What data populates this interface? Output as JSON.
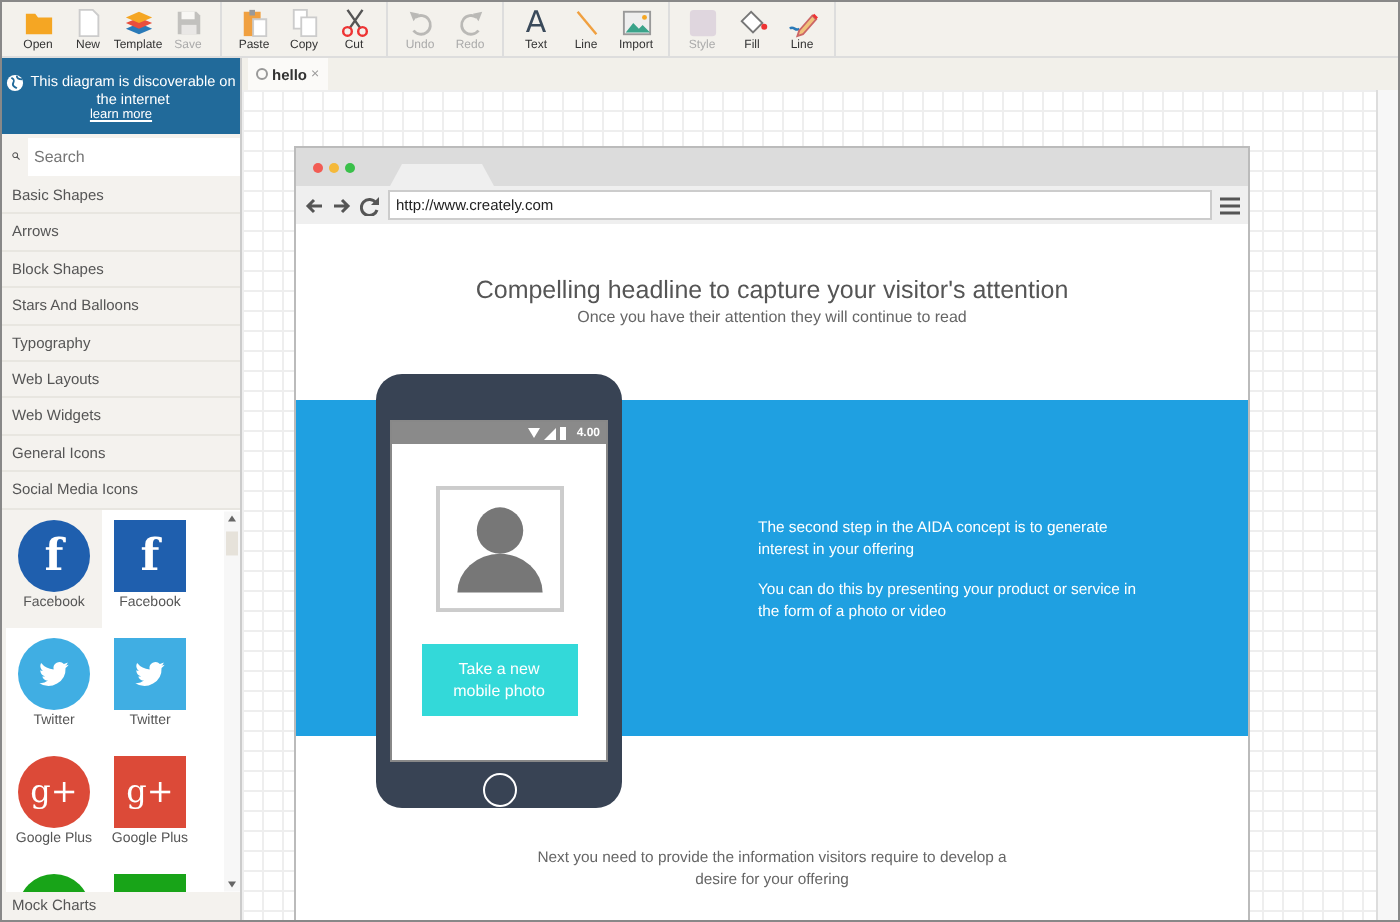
{
  "toolbar": {
    "groups": [
      {
        "items": [
          {
            "label": "Open",
            "kind": "folder",
            "disabled": false
          },
          {
            "label": "New",
            "kind": "page",
            "disabled": false
          },
          {
            "label": "Template",
            "kind": "layers",
            "disabled": false
          },
          {
            "label": "Save",
            "kind": "disk",
            "disabled": true
          }
        ]
      },
      {
        "items": [
          {
            "label": "Paste",
            "kind": "clipboard",
            "disabled": false
          },
          {
            "label": "Copy",
            "kind": "copy",
            "disabled": false
          },
          {
            "label": "Cut",
            "kind": "scissors",
            "disabled": false
          }
        ]
      },
      {
        "items": [
          {
            "label": "Undo",
            "kind": "undo",
            "disabled": true
          },
          {
            "label": "Redo",
            "kind": "redo",
            "disabled": true
          }
        ]
      },
      {
        "items": [
          {
            "label": "Text",
            "kind": "glyph",
            "glyph": "A",
            "disabled": false
          },
          {
            "label": "Line",
            "kind": "line",
            "disabled": false
          },
          {
            "label": "Import",
            "kind": "image",
            "disabled": false
          }
        ]
      },
      {
        "items": [
          {
            "label": "Style",
            "kind": "swatch",
            "disabled": true
          },
          {
            "label": "Fill",
            "kind": "bucket",
            "disabled": false
          },
          {
            "label": "Line",
            "kind": "pen",
            "disabled": false
          }
        ]
      }
    ]
  },
  "sidebar": {
    "banner": {
      "text": "This diagram is discoverable on the internet",
      "link": "learn more"
    },
    "search": {
      "placeholder": "Search"
    },
    "categories": [
      "Basic Shapes",
      "Arrows",
      "Block Shapes",
      "Stars And Balloons",
      "Typography",
      "Web Layouts",
      "Web Widgets",
      "General Icons",
      "Social Media Icons"
    ],
    "shapes": [
      {
        "label": "Facebook",
        "kind": "round",
        "glyph": "f",
        "color": "#1f5fae",
        "selected": true
      },
      {
        "label": "Facebook",
        "kind": "square",
        "glyph": "f",
        "color": "#1f5fae",
        "selected": false
      },
      {
        "label": "Twitter",
        "kind": "round-bird",
        "color": "#40aee3",
        "selected": false
      },
      {
        "label": "Twitter",
        "kind": "square-bird",
        "color": "#40aee3",
        "selected": false
      },
      {
        "label": "Google Plus",
        "kind": "round",
        "glyph": "g+",
        "color": "#dc4a38",
        "selected": false
      },
      {
        "label": "Google Plus",
        "kind": "square",
        "glyph": "g+",
        "color": "#dc4a38",
        "selected": false
      },
      {
        "kind": "round",
        "color": "#18a418",
        "selected": false
      },
      {
        "kind": "square",
        "color": "#18a418",
        "selected": false
      }
    ],
    "footer": "Mock Charts"
  },
  "tabs": [
    {
      "label": "hello",
      "close": "×",
      "selected": true
    }
  ],
  "mockup": {
    "url": "http://www.creately.com",
    "headline": "Compelling headline to capture your visitor's attention",
    "subheadline": "Once you have their attention they will continue to read",
    "phone": {
      "time": "4.00",
      "button": "Take a new mobile photo"
    },
    "band_paragraphs": [
      "The second step in the AIDA concept is to generate interest in your offering",
      "You can do this by presenting your product or service in the form of a photo or video"
    ],
    "bottom_text": "Next you need to provide the information visitors require to develop a desire for your offering"
  }
}
